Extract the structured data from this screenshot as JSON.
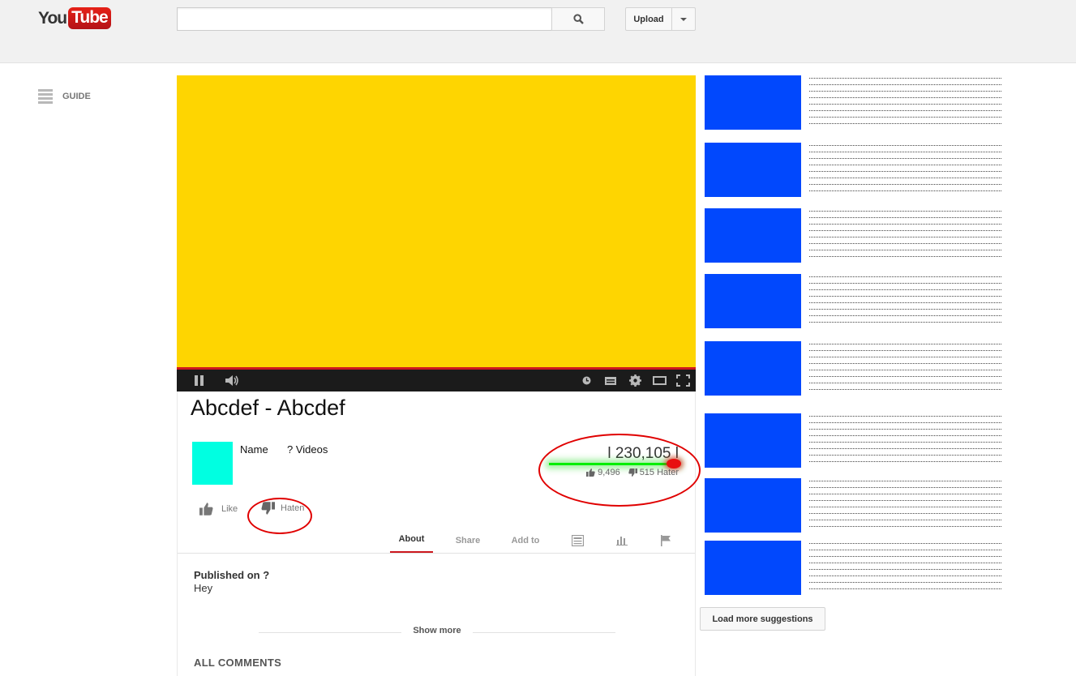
{
  "masthead": {
    "logo_you": "You",
    "logo_tube": "Tube",
    "search_placeholder": "",
    "upload_label": "Upload"
  },
  "guide": {
    "label": "GUIDE"
  },
  "player": {
    "video_color": "#fed501",
    "progress_color": "#cc181e"
  },
  "video": {
    "title": "Abcdef - Abcdef",
    "channel_name": "Name",
    "videos_count": "? Videos",
    "view_count": "l 230,105 l",
    "likes": "9,496",
    "dislikes": "515 Hater",
    "like_label": "Like",
    "dislike_label": "Haten"
  },
  "tabs": [
    {
      "label": "About",
      "active": true
    },
    {
      "label": "Share",
      "active": false
    },
    {
      "label": "Add to",
      "active": false
    }
  ],
  "description": {
    "published": "Published on ?",
    "text": "Hey",
    "show_more": "Show more"
  },
  "comments": {
    "heading": "ALL COMMENTS"
  },
  "sidebar": {
    "thumb_color": "#0148fd",
    "load_more": "Load more suggestions"
  },
  "colors": {
    "brand_red": "#cc181e",
    "avatar": "#00ffe1",
    "annotation": "#e00000"
  }
}
